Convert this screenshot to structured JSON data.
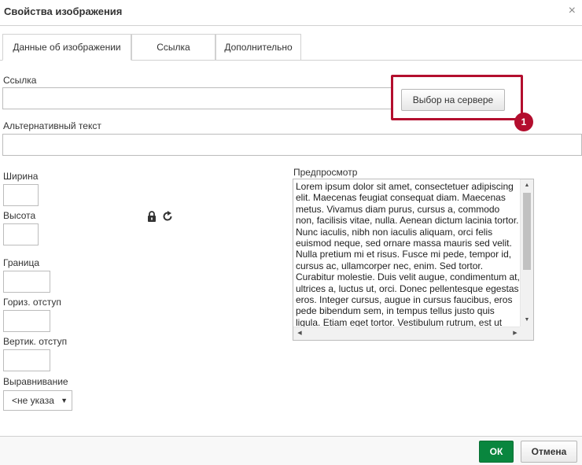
{
  "dialog": {
    "title": "Свойства изображения",
    "close_glyph": "×"
  },
  "tabs": [
    {
      "label": "Данные об изображении",
      "active": true
    },
    {
      "label": "Ссылка",
      "active": false
    },
    {
      "label": "Дополнительно",
      "active": false
    }
  ],
  "form": {
    "url_label": "Ссылка",
    "url_value": "",
    "browse_button": "Выбор на сервере",
    "alt_label": "Альтернативный текст",
    "alt_value": "",
    "width_label": "Ширина",
    "height_label": "Высота",
    "border_label": "Граница",
    "hspace_label": "Гориз. отступ",
    "vspace_label": "Вертик. отступ",
    "align_label": "Выравнивание",
    "align_value": "<не указа",
    "align_arrow": "▼"
  },
  "annotation": {
    "badge_number": "1",
    "color": "#b30e2e"
  },
  "preview": {
    "label": "Предпросмотр",
    "text": "Lorem ipsum dolor sit amet, consectetuer adipiscing elit. Maecenas feugiat consequat diam. Maecenas metus. Vivamus diam purus, cursus a, commodo non, facilisis vitae, nulla. Aenean dictum lacinia tortor. Nunc iaculis, nibh non iaculis aliquam, orci felis euismod neque, sed ornare massa mauris sed velit. Nulla pretium mi et risus. Fusce mi pede, tempor id, cursus ac, ullamcorper nec, enim. Sed tortor. Curabitur molestie. Duis velit augue, condimentum at, ultrices a, luctus ut, orci. Donec pellentesque egestas eros. Integer cursus, augue in cursus faucibus, eros pede bibendum sem, in tempus tellus justo quis ligula. Etiam eget tortor. Vestibulum rutrum, est ut placerat elementum, lectus nisl aliquam velit, tempor aliquam eros nunc nonummy metus."
  },
  "footer": {
    "ok_label": "ОК",
    "cancel_label": "Отмена"
  },
  "colors": {
    "ok_green": "#09863e",
    "highlight_red": "#b30e2e"
  }
}
